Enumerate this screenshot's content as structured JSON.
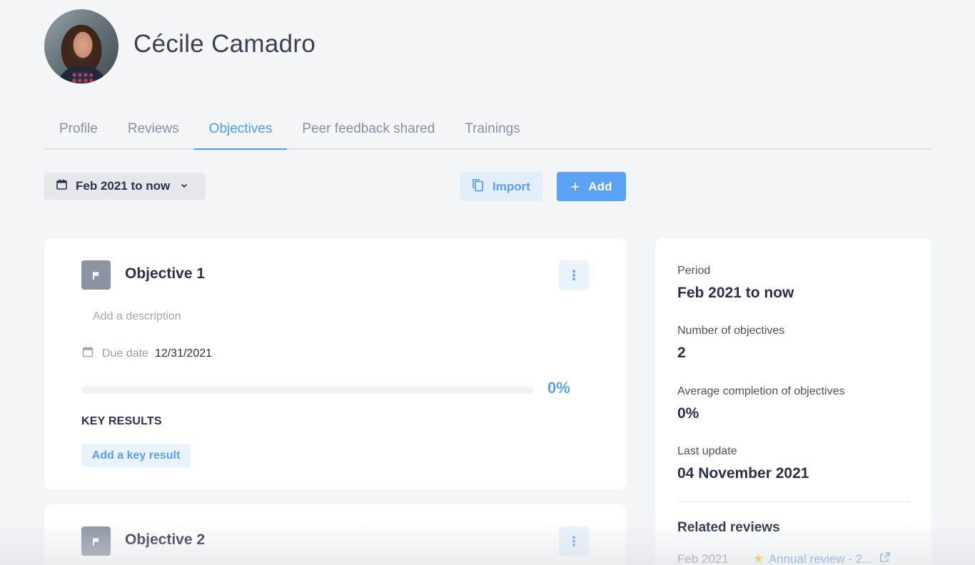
{
  "user": {
    "name": "Cécile Camadro"
  },
  "tabs": [
    {
      "label": "Profile",
      "active": false
    },
    {
      "label": "Reviews",
      "active": false
    },
    {
      "label": "Objectives",
      "active": true
    },
    {
      "label": "Peer feedback shared",
      "active": false
    },
    {
      "label": "Trainings",
      "active": false
    }
  ],
  "toolbar": {
    "period_label": "Feb 2021 to now",
    "import_label": "Import",
    "add_label": "Add"
  },
  "objectives": [
    {
      "title": "Objective 1",
      "description_placeholder": "Add a description",
      "due_label": "Due date",
      "due_value": "12/31/2021",
      "progress_text": "0%",
      "progress_fraction": 0,
      "key_results_title": "KEY RESULTS",
      "add_key_result_label": "Add a key result"
    },
    {
      "title": "Objective 2"
    }
  ],
  "summary": {
    "period_label": "Period",
    "period_value": "Feb 2021 to now",
    "count_label": "Number of objectives",
    "count_value": "2",
    "avg_label": "Average completion of objectives",
    "avg_value": "0%",
    "update_label": "Last update",
    "update_value": "04 November 2021",
    "related_title": "Related reviews",
    "related": [
      {
        "date": "Feb 2021",
        "name": "Annual review - 2...",
        "icon": "star-icon"
      }
    ]
  },
  "colors": {
    "accent": "#5ca2f2",
    "background": "#f3f5f7",
    "text": "#2c2f4a"
  }
}
